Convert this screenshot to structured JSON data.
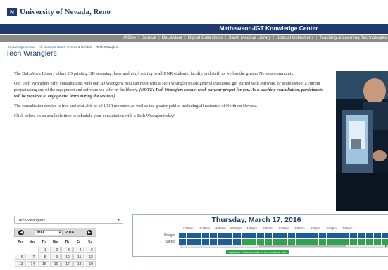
{
  "header": {
    "logo_mark": "N",
    "logo_text": "University of Nevada, Reno"
  },
  "banner": {
    "title": "Mathewson-IGT Knowledge Center"
  },
  "nav": {
    "items": [
      "@One",
      "Basque",
      "DeLaMare",
      "Digital Collections",
      "Savitt Medical Library",
      "Special Collections",
      "Teaching & Learning Technologies"
    ]
  },
  "breadcrumb": {
    "items": [
      "Knowledge Center",
      "All Libraries Hours, Events & Exhibits",
      "Tech Wranglers"
    ]
  },
  "page": {
    "title": "Tech Wranglers"
  },
  "content": {
    "p1": "The DeLaMare Library offers 3D printing, 3D scanning, laser and vinyl cutting to all UNR students, faculty, and staff, as well as the greater Nevada community.",
    "p2": "Our Tech Wranglers offer consultations with our 3D Wrangers. You can meet with a Tech Wrangler to ask general questions, get started with software, or troubleshoot a current project using any of the equipment and software we offer in the library.",
    "p2_note": "(NOTE: Tech Wranglers cannot work on your project for you. As a teaching consultation, participants will be required to engage and learn during the session.)",
    "p3": "The consultation service is free and available to all UNR members as well as the greater public, including all residents of Northern Nevada.",
    "p4": "Click below on an available time to schedule your consultation with a Tech Wrangler today!"
  },
  "select": {
    "value": "Tech Wranglers",
    "arrow": "▾"
  },
  "calendar": {
    "month": "Mar",
    "year": "2016",
    "prev": "◀",
    "next": "▶",
    "days": [
      "Su",
      "Mo",
      "Tu",
      "We",
      "Th",
      "Fr",
      "Sa"
    ],
    "weeks": [
      [
        "",
        "",
        "1",
        "2",
        "3",
        "4",
        "5"
      ],
      [
        "6",
        "7",
        "8",
        "9",
        "10",
        "11",
        "12"
      ],
      [
        "13",
        "14",
        "15",
        "16",
        "17",
        "18",
        "19"
      ]
    ]
  },
  "schedule": {
    "date": "Thursday, March 17, 2016",
    "times": [
      "9:00am",
      "10:00am",
      "11:00am",
      "12:00pm",
      "1:00pm",
      "2:00am",
      "3:00am",
      "4:00pm",
      "5:00pm",
      "6:00pm",
      "7:00am"
    ],
    "rows": [
      {
        "label": "Dwight",
        "slots": [
          "blue",
          "blue",
          "blue",
          "blue",
          "blue",
          "blue",
          "blue",
          "blue",
          "blue",
          "blue",
          "blue",
          "blue",
          "blue",
          "blue",
          "blue",
          "blue",
          "blue",
          "blue",
          "blue",
          "blue",
          "blue",
          "blue",
          "blue",
          "blue",
          "blue",
          "blue",
          "blue"
        ]
      },
      {
        "label": "Sierra",
        "slots": [
          "blue",
          "blue",
          "blue",
          "blue",
          "blue",
          "blue",
          "blue",
          "blue",
          "green",
          "green",
          "green",
          "green",
          "green",
          "green",
          "green",
          "green",
          "green",
          "green",
          "green",
          "green",
          "green",
          "green",
          "green",
          "green",
          "green",
          "green",
          "green"
        ]
      }
    ],
    "legend": "Available - To book, click on any available slot",
    "colors": {
      "booked": "#1f5d96",
      "available": "#2fa34d"
    }
  }
}
